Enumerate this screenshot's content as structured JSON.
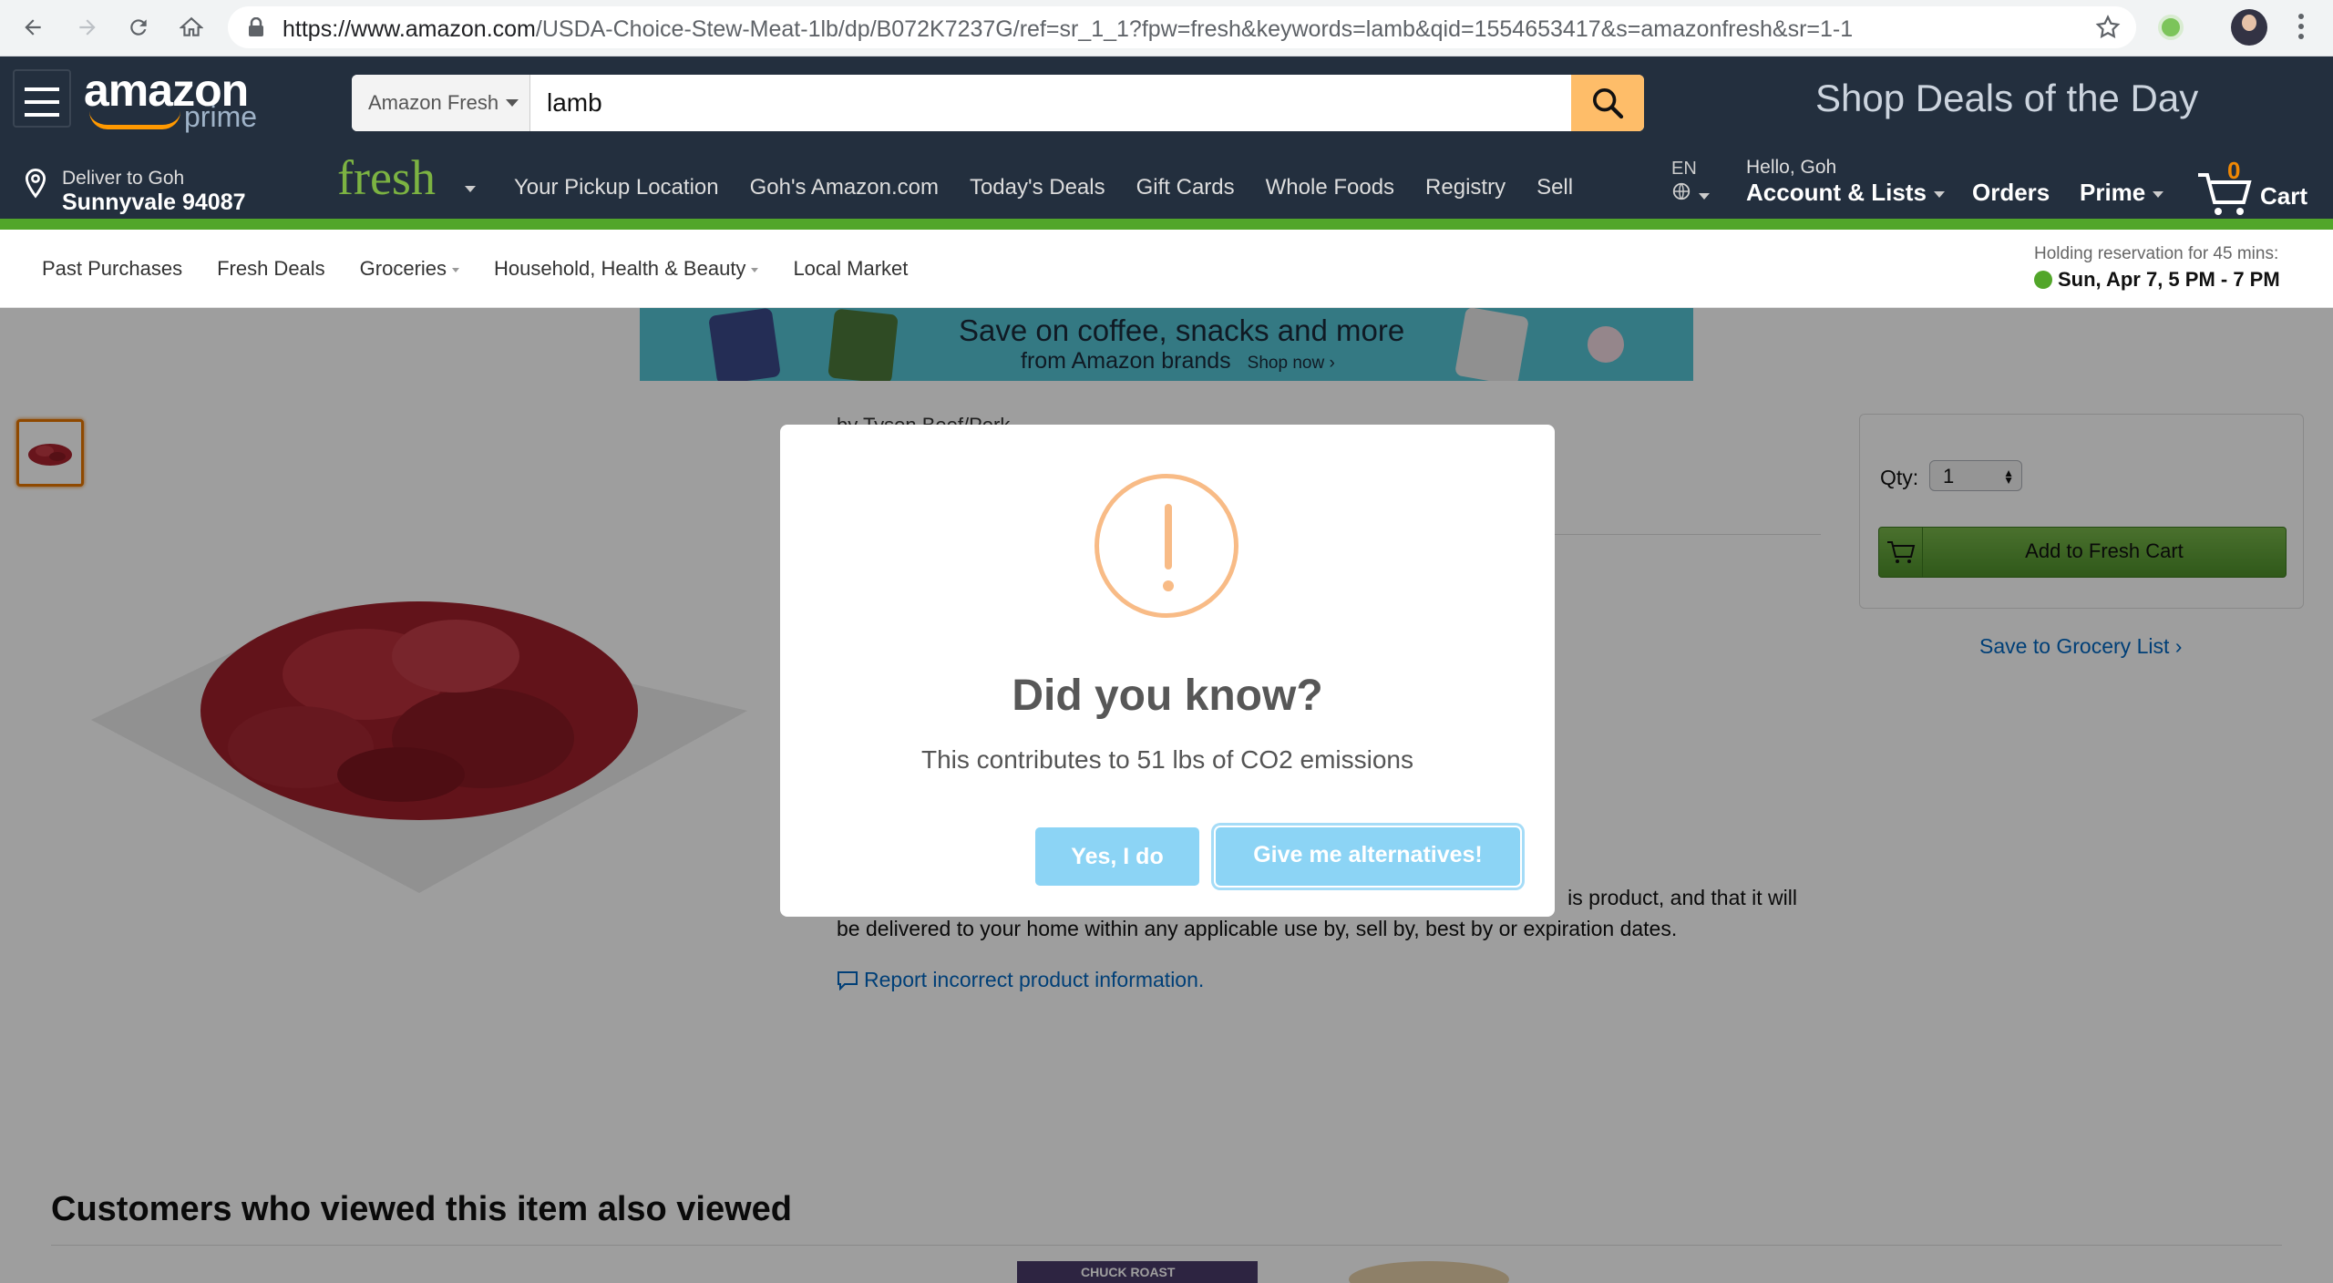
{
  "browser": {
    "url_domain": "https://www.amazon.com",
    "url_path": "/USDA-Choice-Stew-Meat-1lb/dp/B072K7237G/ref=sr_1_1?fpw=fresh&keywords=lamb&qid=1554653417&s=amazonfresh&sr=1-1"
  },
  "header": {
    "search_category": "Amazon Fresh",
    "search_value": "lamb",
    "deals_title": "Shop Deals of the Day",
    "deliver_line1": "Deliver to Goh",
    "deliver_line2": "Sunnyvale 94087",
    "fresh_logo": "fresh",
    "nav_links": [
      "Your Pickup Location",
      "Goh's Amazon.com",
      "Today's Deals",
      "Gift Cards",
      "Whole Foods",
      "Registry",
      "Sell"
    ],
    "language": "EN",
    "greeting": "Hello, Goh",
    "account_label": "Account & Lists",
    "orders_label": "Orders",
    "prime_label": "Prime",
    "cart_count": "0",
    "cart_label": "Cart"
  },
  "subnav": {
    "items": [
      "Past Purchases",
      "Fresh Deals",
      "Groceries",
      "Household, Health & Beauty",
      "Local Market"
    ],
    "holding_text": "Holding reservation for 45 mins:",
    "holding_window": "Sun, Apr 7, 5 PM - 7 PM"
  },
  "banner": {
    "line1": "Save on coffee, snacks and more",
    "line2": "from Amazon brands",
    "cta": "Shop now ›"
  },
  "product": {
    "byline": "by Tyson Beef/Pork",
    "description_tail": "is product, and that it will",
    "description_line2": "be delivered to your home within any applicable use by, sell by, best by or expiration dates.",
    "report_link": "Report incorrect product information."
  },
  "buybox": {
    "qty_label": "Qty:",
    "qty_value": "1",
    "add_button": "Add to Fresh Cart",
    "save_list": "Save to Grocery List ›"
  },
  "recommendations": {
    "title": "Customers who viewed this item also viewed",
    "item1_label": "CHUCK ROAST"
  },
  "modal": {
    "title": "Did you know?",
    "text": "This contributes to 51 lbs of CO2 emissions",
    "yes_button": "Yes, I do",
    "alt_button": "Give me alternatives!"
  },
  "colors": {
    "amazon_nav": "#232f3e",
    "fresh_green": "#52a62a",
    "search_button": "#febd69",
    "warning_orange": "#f8bb86",
    "modal_button": "#8cd4f5",
    "link_blue": "#0066c0"
  }
}
